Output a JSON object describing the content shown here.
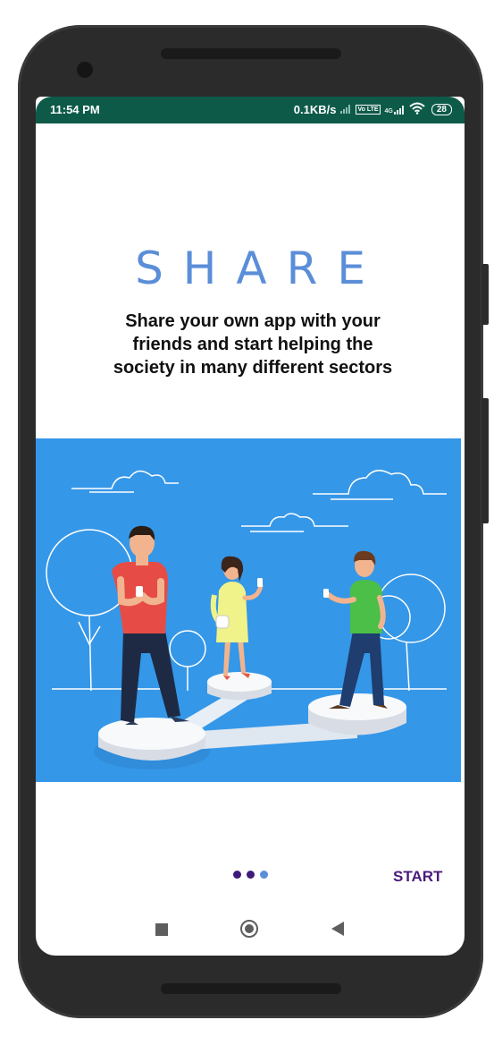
{
  "status_bar": {
    "time": "11:54 PM",
    "net_speed": "0.1KB/s",
    "network_type": "4G",
    "volte": "Vo LTE",
    "battery": "28",
    "icons": [
      "signal-icon",
      "volte-icon",
      "signal-4g-icon",
      "wifi-icon",
      "battery-icon"
    ]
  },
  "onboarding": {
    "title": "SHARE",
    "description": "Share your own app with your friends and start helping the society in many different sectors",
    "illustration": "people-sharing-illustration"
  },
  "pager": {
    "dots": [
      {
        "color": "#3d1a78",
        "active": true
      },
      {
        "color": "#3d1a78",
        "active": true
      },
      {
        "color": "#5b8ed8",
        "active": false
      }
    ]
  },
  "footer": {
    "start_label": "START"
  },
  "nav_bar": {
    "icons": [
      "recent-apps-icon",
      "home-icon",
      "back-icon"
    ]
  },
  "colors": {
    "status_bar": "#0d5a49",
    "title": "#5b8ed8",
    "illustration_bg": "#3597e8",
    "accent": "#4a1a7a"
  }
}
